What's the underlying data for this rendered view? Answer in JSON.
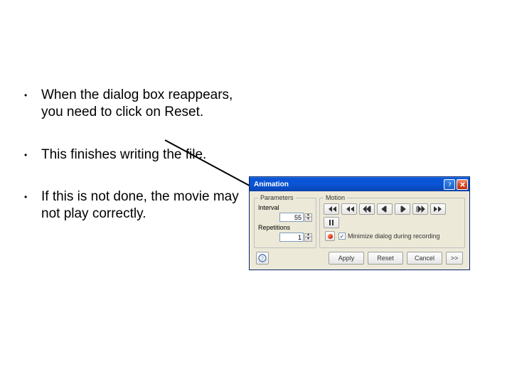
{
  "bullets": [
    "When the dialog box reappears, you need to click on Reset.",
    "This finishes writing the file.",
    "If this is not done, the movie may not play correctly."
  ],
  "dialog": {
    "title": "Animation",
    "groups": {
      "parameters": {
        "legend": "Parameters",
        "interval_label": "Interval",
        "interval_value": "55",
        "repetitions_label": "Repetitions",
        "repetitions_value": "1"
      },
      "motion": {
        "legend": "Motion",
        "minimize_label": "Minimize dialog during recording",
        "minimize_checked": true
      }
    },
    "buttons": {
      "apply": "Apply",
      "reset": "Reset",
      "cancel": "Cancel",
      "expand": ">>"
    }
  }
}
